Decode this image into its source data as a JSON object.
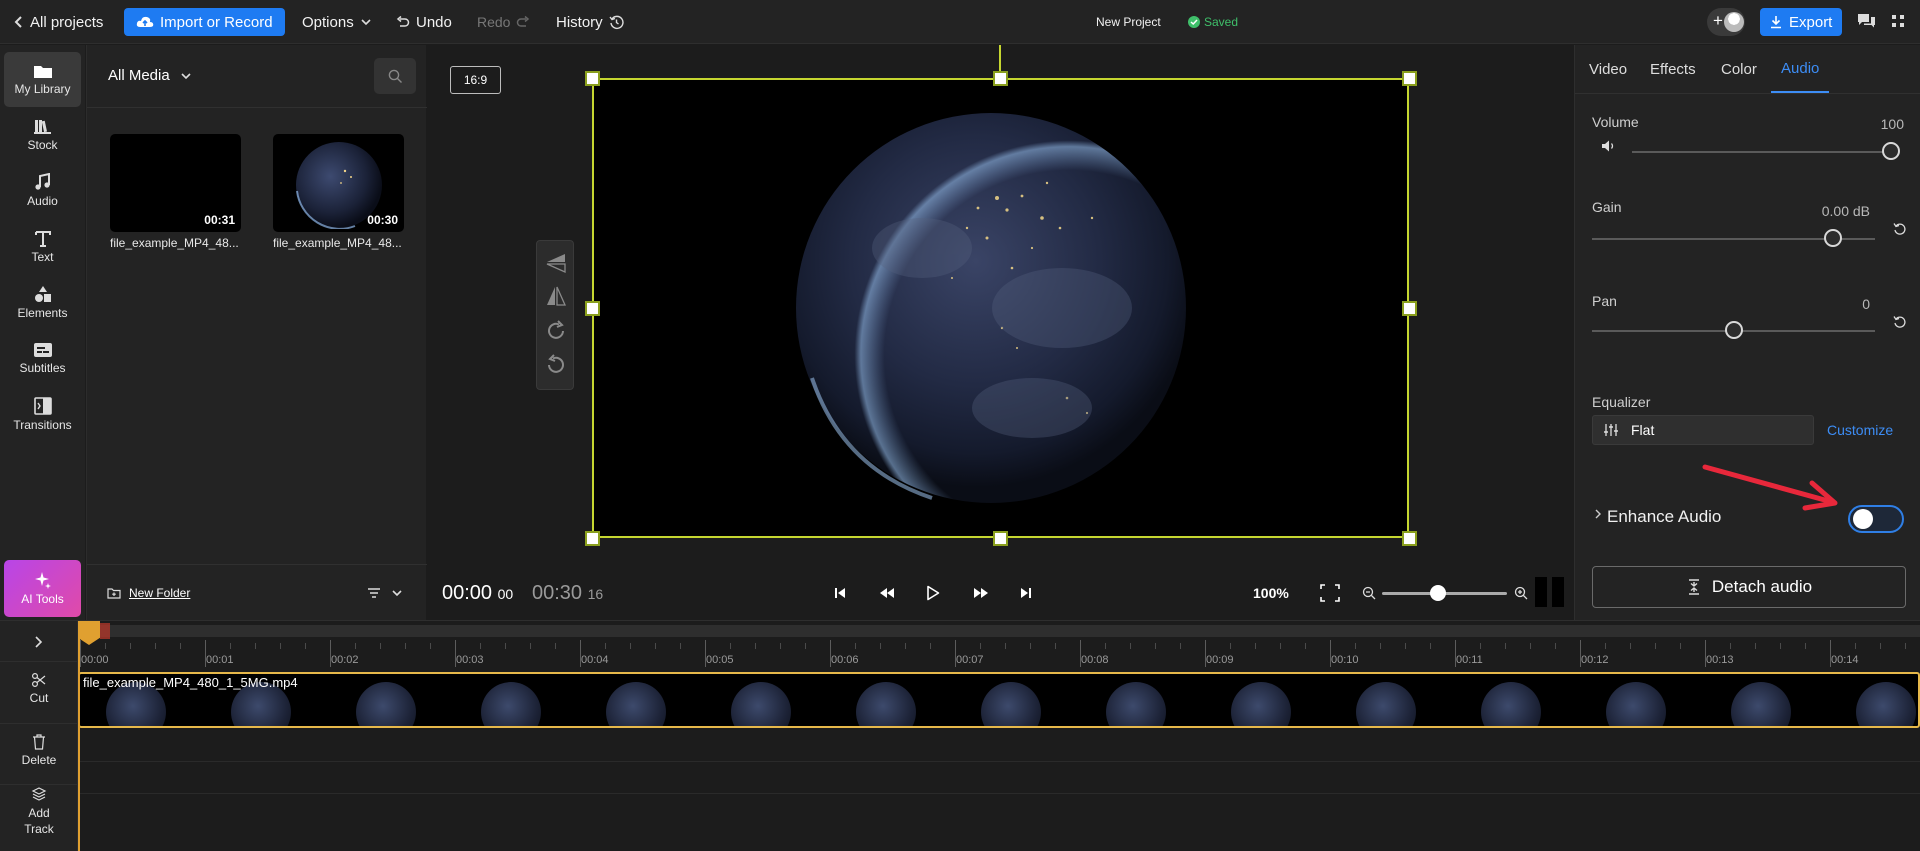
{
  "topbar": {
    "back_label": "All projects",
    "import_label": "Import or Record",
    "options_label": "Options",
    "undo_label": "Undo",
    "redo_label": "Redo",
    "history_label": "History",
    "project_name": "New Project",
    "saved_label": "Saved",
    "export_label": "Export"
  },
  "rail": {
    "items": [
      {
        "label": "My Library",
        "icon": "library-icon"
      },
      {
        "label": "Stock",
        "icon": "stock-icon"
      },
      {
        "label": "Audio",
        "icon": "music-note-icon"
      },
      {
        "label": "Text",
        "icon": "text-icon"
      },
      {
        "label": "Elements",
        "icon": "shapes-icon"
      },
      {
        "label": "Subtitles",
        "icon": "subtitles-icon"
      },
      {
        "label": "Transitions",
        "icon": "transitions-icon"
      }
    ],
    "ai_tools_label": "AI Tools"
  },
  "media": {
    "filter_label": "All Media",
    "items": [
      {
        "name": "file_example_MP4_48...",
        "duration": "00:31"
      },
      {
        "name": "file_example_MP4_48...",
        "duration": "00:30"
      }
    ],
    "new_folder_label": "New Folder"
  },
  "preview": {
    "aspect_label": "16:9",
    "current_time": "00:00",
    "current_frames": "00",
    "total_time": "00:30",
    "total_frames": "16",
    "zoom_label": "100%",
    "zoom_level": 0.45
  },
  "props": {
    "tabs": [
      "Video",
      "Effects",
      "Color",
      "Audio"
    ],
    "active_tab": "Audio",
    "volume": {
      "label": "Volume",
      "value_text": "100",
      "level": 1.0
    },
    "gain": {
      "label": "Gain",
      "value_text": "0.00 dB",
      "level": 0.85
    },
    "pan": {
      "label": "Pan",
      "value_text": "0",
      "level": 0.5
    },
    "equalizer": {
      "label": "Equalizer",
      "preset": "Flat",
      "customize_label": "Customize"
    },
    "enhance_audio": {
      "label": "Enhance Audio",
      "enabled": false
    },
    "detach_label": "Detach audio"
  },
  "timeline": {
    "tools": [
      {
        "label": "Cut",
        "icon": "scissors-icon"
      },
      {
        "label": "Delete",
        "icon": "trash-icon"
      },
      {
        "label": "Add Track",
        "icon": "layers-icon"
      }
    ],
    "ticks": [
      "00:00",
      "00:01",
      "00:02",
      "00:03",
      "00:04",
      "00:05",
      "00:06",
      "00:07",
      "00:08",
      "00:09",
      "00:10",
      "00:11",
      "00:12",
      "00:13",
      "00:14"
    ],
    "clip_name": "file_example_MP4_480_1_5MG.mp4"
  },
  "colors": {
    "accent": "#1e7bf2",
    "selection": "#c5d630",
    "playhead": "#e0a030",
    "clip_border": "#e6b84a"
  }
}
